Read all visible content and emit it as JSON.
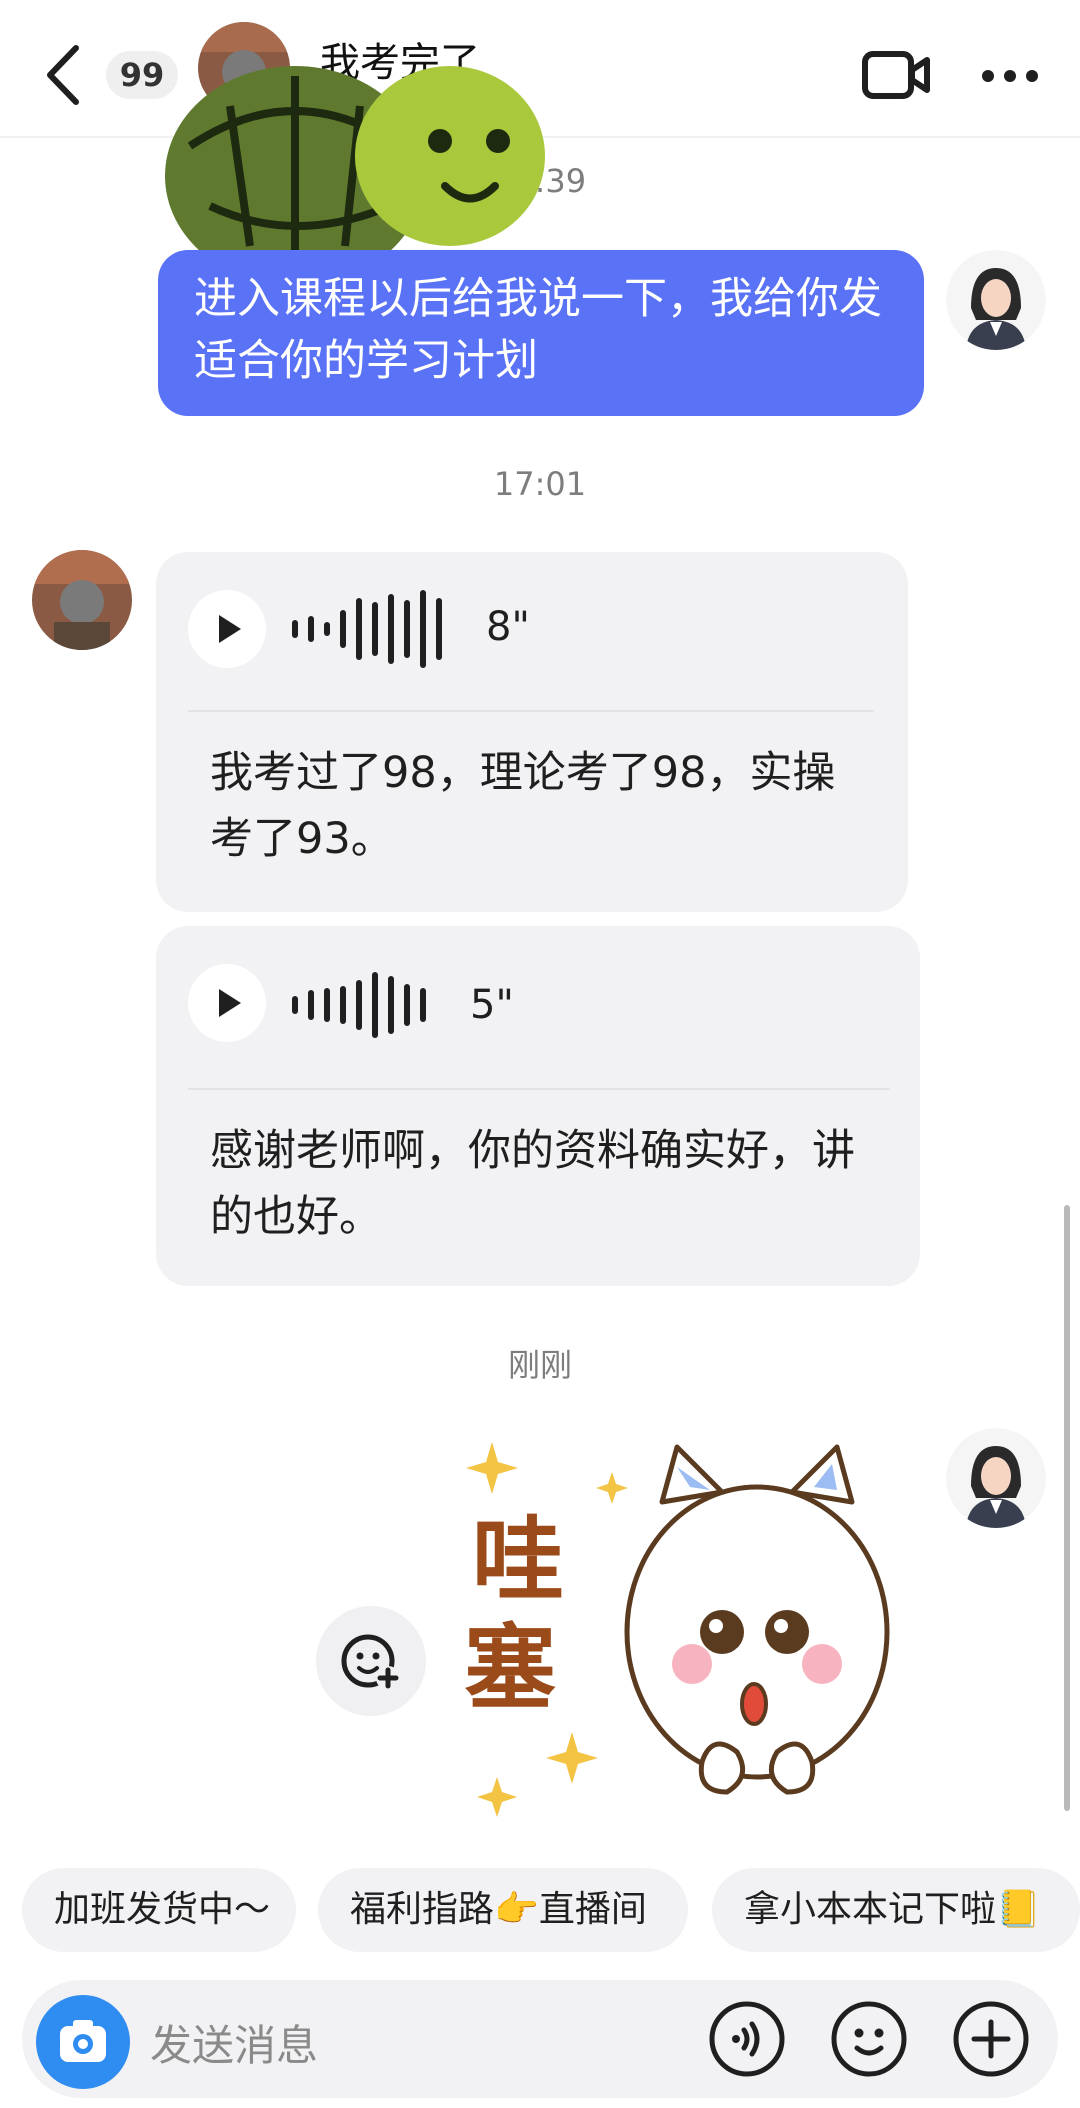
{
  "header": {
    "unread_count": "99",
    "title": "我考完了",
    "icons": [
      "back-icon",
      "video-call-icon",
      "more-icon"
    ]
  },
  "messages": {
    "time_1": "15:39",
    "outgoing_1": "进入课程以后给我说一下，我给你发适合你的学习计划",
    "time_2": "17:01",
    "voice_1": {
      "duration": "8\"",
      "text": "我考过了98，理论考了98，实操考了93。"
    },
    "voice_2": {
      "duration": "5\"",
      "text": "感谢老师啊，你的资料确实好，讲的也好。"
    },
    "time_3": "刚刚",
    "sticker_outgoing": {
      "text": "哇塞"
    }
  },
  "quick_replies": [
    "加班发货中～",
    "福利指路👉直播间",
    "拿小本本记下啦📒"
  ],
  "input": {
    "placeholder": "发送消息"
  },
  "colors": {
    "accent": "#5a72f5",
    "camera": "#2f8cf0",
    "bubble_in": "#f2f2f4"
  }
}
